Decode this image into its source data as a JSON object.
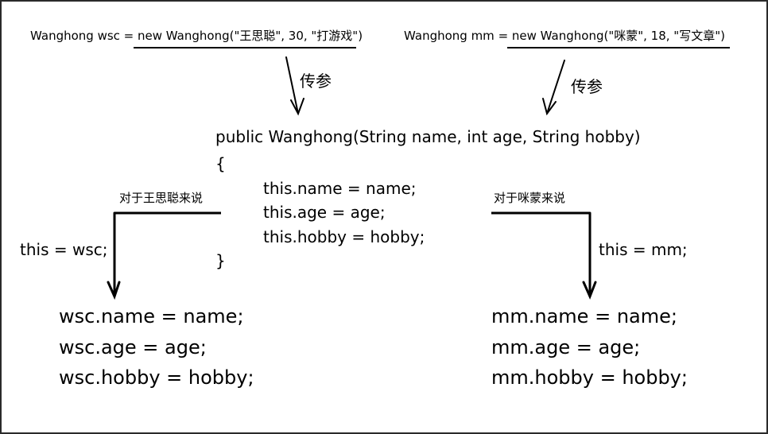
{
  "top_left": {
    "prefix": "Wanghong wsc = ",
    "call": "new Wanghong(\"王思聪\", 30, \"打游戏\")"
  },
  "top_right": {
    "prefix": "Wanghong mm = ",
    "call": "new Wanghong(\"咪蒙\", 18, \"写文章\")"
  },
  "arrow_labels": {
    "left": "传参",
    "right": "传参"
  },
  "constructor": {
    "signature": "public Wanghong(String name, int age, String hobby)",
    "open_brace": "{",
    "close_brace": "}",
    "body": [
      "this.name = name;",
      "this.age = age;",
      "this.hobby = hobby;"
    ]
  },
  "left_branch": {
    "heading": "对于王思聪来说",
    "binding": "this = wsc;",
    "result": [
      "wsc.name = name;",
      "wsc.age = age;",
      "wsc.hobby = hobby;"
    ]
  },
  "right_branch": {
    "heading": "对于咪蒙来说",
    "binding": "this = mm;",
    "result": [
      "mm.name = name;",
      "mm.age = age;",
      "mm.hobby = hobby;"
    ]
  }
}
